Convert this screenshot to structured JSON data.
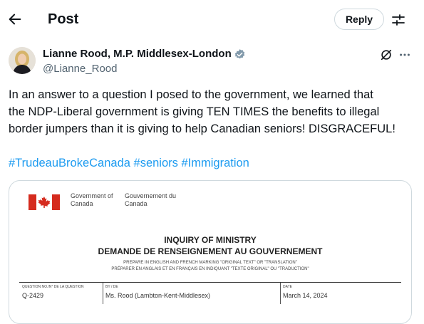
{
  "header": {
    "title": "Post",
    "reply_label": "Reply"
  },
  "author": {
    "name": "Lianne Rood, M.P. Middlesex-London",
    "handle": "@Lianne_Rood"
  },
  "post": {
    "lines": [
      "In an answer to a question I posed to the government, we learned that",
      "the NDP-Liberal government is giving TEN TIMES the benefits to illegal",
      "border jumpers than it is giving to help Canadian seniors! DISGRACEFUL!"
    ],
    "hashtags": [
      "#TrudeauBrokeCanada",
      "#seniors",
      "#Immigration"
    ]
  },
  "document": {
    "gov_en": "Government of Canada",
    "gov_fr": "Gouvernement du Canada",
    "title_en": "INQUIRY OF MINISTRY",
    "title_fr": "DEMANDE DE RENSEIGNEMENT AU GOUVERNEMENT",
    "note_en": "PREPARE IN ENGLISH AND FRENCH MARKING \"ORIGINAL TEXT\" OR \"TRANSLATION\"",
    "note_fr": "PRÉPARER EN ANGLAIS ET EN FRANÇAIS EN INDIQUANT \"TEXTE ORIGINAL\" OU \"TRADUCTION\"",
    "field_labels": [
      "QUESTION NO./N° DE LA QUESTION",
      "BY / DE",
      "DATE"
    ],
    "field_values": [
      "Q-2429",
      "Ms. Rood (Lambton-Kent-Middlesex)",
      "March 14, 2024"
    ]
  },
  "colors": {
    "link": "#1d9bf0",
    "verified": "#829aab",
    "flag_red": "#d52b1e",
    "text": "#0f1419",
    "muted": "#536471"
  },
  "icons": [
    "back-arrow-icon",
    "tune-icon",
    "verified-badge-icon",
    "grok-icon",
    "more-icon",
    "canada-flag-icon"
  ]
}
